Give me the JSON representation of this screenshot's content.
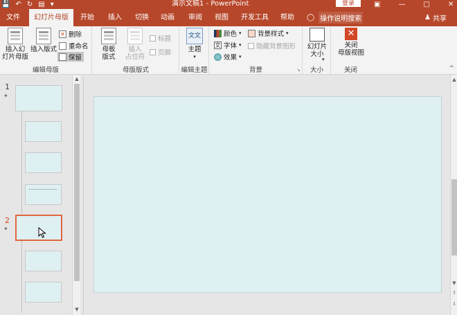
{
  "titlebar": {
    "title": "演示文稿1 - PowerPoint",
    "login": "登录",
    "quick_icons": [
      "save-icon",
      "undo-icon",
      "redo-icon",
      "present-icon"
    ],
    "accent": "#b7472a"
  },
  "tabs": [
    {
      "label": "文件"
    },
    {
      "label": "幻灯片母版",
      "active": true
    },
    {
      "label": "开始"
    },
    {
      "label": "插入"
    },
    {
      "label": "切换"
    },
    {
      "label": "动画"
    },
    {
      "label": "审阅"
    },
    {
      "label": "视图"
    },
    {
      "label": "开发工具"
    },
    {
      "label": "帮助"
    }
  ],
  "tell_me": "操作说明搜索",
  "share": "共享",
  "ribbon": {
    "edit_master": {
      "label": "编辑母版",
      "insert_master": "插入幻\n灯片母版",
      "insert_layout": "插入版式",
      "delete": "删除",
      "rename": "重命名",
      "preserve": "保留"
    },
    "master_layout": {
      "label": "母版版式",
      "master_layout_btn": "母板\n版式",
      "insert_placeholder": "插入\n占位符",
      "title_check": "标题",
      "footer_check": "页脚"
    },
    "edit_theme": {
      "label": "编辑主题",
      "themes": "主题"
    },
    "background": {
      "label": "背景",
      "colors": "颜色",
      "fonts": "字体",
      "effects": "效果",
      "bg_styles": "背景样式",
      "hide_bg": "隐藏背景图形"
    },
    "size": {
      "label": "大小",
      "slide_size": "幻灯片\n大小"
    },
    "close": {
      "label": "关闭",
      "close_master": "关闭\n母版视图"
    }
  },
  "thumbnails": {
    "numbers": [
      "1",
      "2"
    ],
    "slide_bg": "#dff0f2",
    "selection_color": "#e0663d"
  }
}
